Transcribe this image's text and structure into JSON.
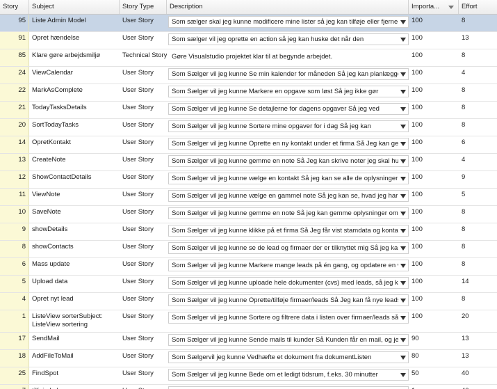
{
  "columns": {
    "story": "Story",
    "subject": "Subject",
    "story_type": "Story Type",
    "description": "Description",
    "importance": "Importa...",
    "effort": "Effort"
  },
  "rows": [
    {
      "story": "95",
      "subject": "Liste Admin Model",
      "type": "User Story",
      "desc": "Som sælger skal jeg kunne modificere mine lister så jeg kan tilføje eller fjerne",
      "imp": "100",
      "eff": "8"
    },
    {
      "story": "91",
      "subject": "Opret hændelse",
      "type": "User Story",
      "desc": "Som sælger vil jeg oprette en action så jeg kan huske det når den",
      "imp": "100",
      "eff": "13"
    },
    {
      "story": "85",
      "subject": "Klare gøre arbejdsmiljø",
      "type": "Technical Story",
      "desc": "Gøre Visualstudio projektet klar til at begynde arbejdet.",
      "imp": "100",
      "eff": "8"
    },
    {
      "story": "24",
      "subject": "ViewCalendar",
      "type": "User Story",
      "desc": "Som Sælger vil jeg kunne  Se min kalender for måneden Så jeg kan planlægge",
      "imp": "100",
      "eff": "4"
    },
    {
      "story": "22",
      "subject": "MarkAsComplete",
      "type": "User Story",
      "desc": "Som Sælger vil jeg kunne  Markere en opgave som løst Så jeg ikke gør",
      "imp": "100",
      "eff": "8"
    },
    {
      "story": "21",
      "subject": "TodayTasksDetails",
      "type": "User Story",
      "desc": "Som  Sælger vil jeg kunne  Se detajlerne for dagens opgaver Så jeg ved",
      "imp": "100",
      "eff": "8"
    },
    {
      "story": "20",
      "subject": "SortTodayTasks",
      "type": "User Story",
      "desc": "Som Sælger vil jeg kunne  Sortere mine opgaver for i dag Så jeg kan",
      "imp": "100",
      "eff": "8"
    },
    {
      "story": "14",
      "subject": "OpretKontakt",
      "type": "User Story",
      "desc": "Som Sælger vil jeg kunne  Oprette en ny kontakt under et firma Så Jeg kan gemme",
      "imp": "100",
      "eff": "6"
    },
    {
      "story": "13",
      "subject": "CreateNote",
      "type": "User Story",
      "desc": "Som Sælger vil jeg kunne  gemme en note Så Jeg kan skrive noter jeg skal huske",
      "imp": "100",
      "eff": "4"
    },
    {
      "story": "12",
      "subject": "ShowContactDetails",
      "type": "User Story",
      "desc": "Som Sælger vil jeg kunne  vælge en kontakt Så jeg kan se alle de oplysninger jeg",
      "imp": "100",
      "eff": "9"
    },
    {
      "story": "11",
      "subject": "ViewNote",
      "type": "User Story",
      "desc": "Som Sælger vil jeg kunne  vælge en gammel note Så jeg kan se, hvad jeg har skrevet",
      "imp": "100",
      "eff": "5"
    },
    {
      "story": "10",
      "subject": "SaveNote",
      "type": "User Story",
      "desc": "Som Sælger vil jeg kunne  gemme en note Så jeg kan gemme oplysninger om firmaet",
      "imp": "100",
      "eff": "8"
    },
    {
      "story": "9",
      "subject": "showDetails",
      "type": "User Story",
      "desc": "Som Sælger vil jeg kunne  klikke på et firma  Så Jeg får vist stamdata og kontakter",
      "imp": "100",
      "eff": "8"
    },
    {
      "story": "8",
      "subject": "showContacts",
      "type": "User Story",
      "desc": "Som Sælger vil jeg kunne  se de lead og firmaer der er tilknyttet mig Så jeg kan",
      "imp": "100",
      "eff": "8"
    },
    {
      "story": "6",
      "subject": "Mass update",
      "type": "User Story",
      "desc": "Som Sælger vil jeg kunne  Markere mange leads på én gang, og opdatere en værdi",
      "imp": "100",
      "eff": "8"
    },
    {
      "story": "5",
      "subject": "Upload data",
      "type": "User Story",
      "desc": "Som Sælger vil jeg kunne  uploade hele dokumenter (cvs) med leads, så jeg kan",
      "imp": "100",
      "eff": "14"
    },
    {
      "story": "4",
      "subject": "Opret nyt lead",
      "type": "User Story",
      "desc": "Som Sælger vil jeg kunne Oprette/tilføje firmaer/leads Så Jeg kan få nye leads ind",
      "imp": "100",
      "eff": "8"
    },
    {
      "story": "1",
      "subject": "ListeView sorterSubject: ListeView sortering",
      "type": "User Story",
      "desc": "Som Sælger vil jeg kunne Sortere og filtrere data i listen over firmaer/leads så jeg",
      "imp": "100",
      "eff": "20"
    },
    {
      "story": "17",
      "subject": "SendMail",
      "type": "User Story",
      "desc": "Som  Sælger vil jeg kunne  Sende mails til kunder Så Kunden får en mail, og jeg",
      "imp": "90",
      "eff": "13"
    },
    {
      "story": "18",
      "subject": "AddFileToMail",
      "type": "User Story",
      "desc": "Som Sælgervil jeg kunne Vedhæfte et dokument fra dokumentListen",
      "imp": "80",
      "eff": "13"
    },
    {
      "story": "25",
      "subject": "FindSpot",
      "type": "User Story",
      "desc": "Som Sælger vil jeg kunne Bede om et ledigt tidsrum, f.eks. 30 minutter",
      "imp": "50",
      "eff": "40"
    },
    {
      "story": "7",
      "subject": "tilføje kolonne",
      "type": "User Story",
      "desc": "Som Sælger vil jeg kunne  kunne tilføje en kolonne hvor jeg selv bestemmer titlen",
      "imp": "1",
      "eff": "40"
    }
  ]
}
